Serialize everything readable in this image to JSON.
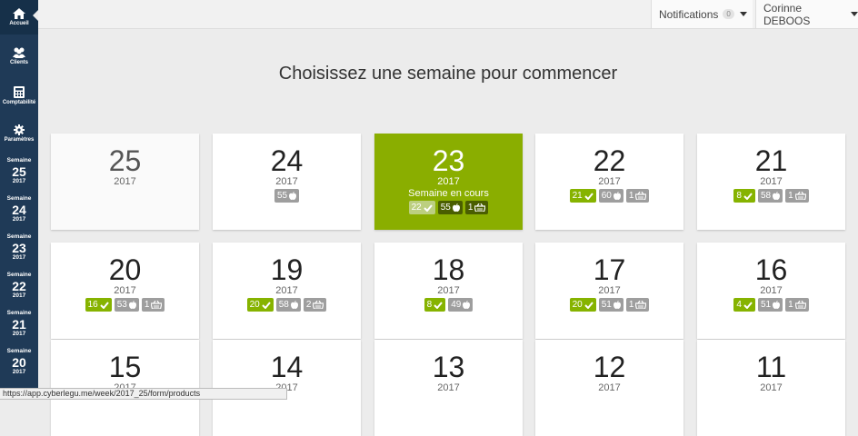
{
  "sidebar": {
    "items": [
      {
        "label": "Accueil",
        "icon": "home-icon"
      },
      {
        "label": "Clients",
        "icon": "users-icon"
      },
      {
        "label": "Comptabilité",
        "icon": "calculator-icon"
      },
      {
        "label": "Paramètres",
        "icon": "gear-icon"
      }
    ],
    "weeks": [
      {
        "label": "Semaine",
        "num": "25",
        "year": "2017"
      },
      {
        "label": "Semaine",
        "num": "24",
        "year": "2017"
      },
      {
        "label": "Semaine",
        "num": "23",
        "year": "2017"
      },
      {
        "label": "Semaine",
        "num": "22",
        "year": "2017"
      },
      {
        "label": "Semaine",
        "num": "21",
        "year": "2017"
      },
      {
        "label": "Semaine",
        "num": "20",
        "year": "2017"
      }
    ]
  },
  "topbar": {
    "notifications_label": "Notifications",
    "notifications_count": "0",
    "user_name": "Corinne DEBOOS"
  },
  "heading": "Choisissez une semaine pour commencer",
  "cards": [
    {
      "num": "25",
      "year": "2017"
    },
    {
      "num": "24",
      "year": "2017",
      "apples": "55"
    },
    {
      "num": "23",
      "year": "2017",
      "current_label": "Semaine en cours",
      "checks": "22",
      "apples": "55",
      "baskets": "1"
    },
    {
      "num": "22",
      "year": "2017",
      "checks": "21",
      "apples": "60",
      "baskets": "1"
    },
    {
      "num": "21",
      "year": "2017",
      "checks": "8",
      "apples": "58",
      "baskets": "1"
    },
    {
      "num": "20",
      "year": "2017",
      "checks": "16",
      "apples": "53",
      "baskets": "1"
    },
    {
      "num": "19",
      "year": "2017",
      "checks": "20",
      "apples": "58",
      "baskets": "2"
    },
    {
      "num": "18",
      "year": "2017",
      "checks": "8",
      "apples": "49"
    },
    {
      "num": "17",
      "year": "2017",
      "checks": "20",
      "apples": "51",
      "baskets": "1"
    },
    {
      "num": "16",
      "year": "2017",
      "checks": "4",
      "apples": "51",
      "baskets": "1"
    },
    {
      "num": "15",
      "year": "2017"
    },
    {
      "num": "14",
      "year": "2017"
    },
    {
      "num": "13",
      "year": "2017"
    },
    {
      "num": "12",
      "year": "2017"
    },
    {
      "num": "11",
      "year": "2017"
    }
  ],
  "statusbar_url": "https://app.cyberlegu.me/week/2017_25/form/products",
  "colors": {
    "sidebar": "#1f3a57",
    "accent_green": "#8aae00",
    "badge_grey": "#9e9e9e"
  }
}
